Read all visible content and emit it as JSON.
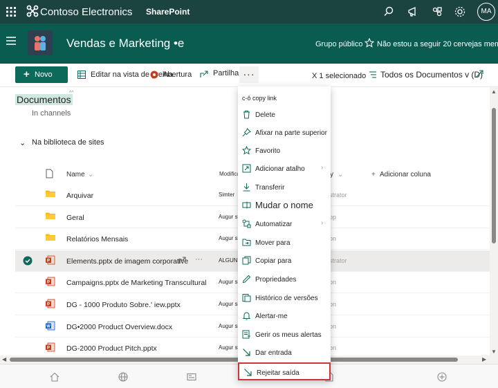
{
  "suite_bar": {
    "brand": "Contoso Electronics",
    "app": "SharePoint",
    "avatar_initials": "MA",
    "icons": [
      "app-launcher-icon",
      "search-icon",
      "megaphone-icon",
      "share-icon",
      "settings-icon"
    ]
  },
  "site_header": {
    "title": "Vendas e Marketing •e",
    "group_label": "Grupo público",
    "follow_text": "Não estou a seguir 20 cervejas mem"
  },
  "command_bar": {
    "new_label": "Novo",
    "grid_edit_label": "Editar na vista de grelha",
    "open_label": "Abertura",
    "share_label": "Partilhar",
    "more_label": "···",
    "selected_label": "X 1 selecionado",
    "view_label": "Todos os Documentos v (D)"
  },
  "content": {
    "heading": "Documentos",
    "heading_tip": "^^",
    "in_channels": "In channels",
    "library_toggle": "⌄",
    "library_label": "Na biblioteca de sites",
    "columns": {
      "name": "Name",
      "modified": "Modificar",
      "modified_by": "y",
      "add_column": "Adicionar coluna"
    },
    "rows": [
      {
        "name": "Arquivar",
        "modby": "Simter",
        "other": "strator",
        "type": "folder"
      },
      {
        "name": "Geral",
        "modby": "Augur sty",
        "other": "pp",
        "type": "folder"
      },
      {
        "name": "Relatórios Mensais",
        "modby": "Augur sty",
        "other": "on",
        "type": "folder"
      },
      {
        "name": "Elements.pptx de imagem corporative",
        "modby": "ALGUNS S CO",
        "other": "strator",
        "type": "pptx",
        "selected": true
      },
      {
        "name": "Campaigns.pptx de Marketing Transcultural",
        "modby": "Augur st",
        "other": "on",
        "type": "pptx"
      },
      {
        "name": "DG - 1000 Produto Sobre.' iew.pptx",
        "modby": "Augur sty",
        "other": "on",
        "type": "pptx"
      },
      {
        "name": "DG•2000 Product Overview.docx",
        "modby": "Augur sty",
        "other": "on",
        "type": "docx"
      },
      {
        "name": "DG-2000 Product Pitch.pptx",
        "modby": "Augur sty",
        "other": "on",
        "type": "pptx"
      }
    ]
  },
  "context_menu": {
    "items": [
      {
        "label": "c-ô copy link",
        "icon": "none"
      },
      {
        "label": "Delete",
        "icon": "trash-icon"
      },
      {
        "label": "Afixar na parte superior",
        "icon": "pin-icon"
      },
      {
        "label": "Favorito",
        "icon": "star-icon"
      },
      {
        "label": "Adicionar atalho",
        "icon": "shortcut-icon",
        "submenu": true
      },
      {
        "label": "Transferir",
        "icon": "download-icon"
      },
      {
        "label": "Mudar o nome",
        "icon": "rename-icon"
      },
      {
        "label": "Automatizar",
        "icon": "automate-icon",
        "submenu": true
      },
      {
        "label": "Mover para",
        "icon": "move-icon"
      },
      {
        "label": "Copiar para",
        "icon": "copy-icon"
      },
      {
        "label": "Propriedades",
        "icon": "pencil-icon"
      },
      {
        "label": "Histórico de versões",
        "icon": "history-icon"
      },
      {
        "label": "Alertar-me",
        "icon": "bell-icon"
      },
      {
        "label": "Gerir os meus alertas",
        "icon": "manage-alerts-icon"
      },
      {
        "label": "Dar entrada",
        "icon": "checkin-icon"
      },
      {
        "label": "Rejeitar saída",
        "icon": "discard-checkout-icon",
        "highlighted": true
      }
    ]
  },
  "colors": {
    "suite_bar": "#1b4340",
    "site_header": "#0a5c50",
    "accent": "#0b6a5a",
    "highlight_border": "#d13438"
  }
}
